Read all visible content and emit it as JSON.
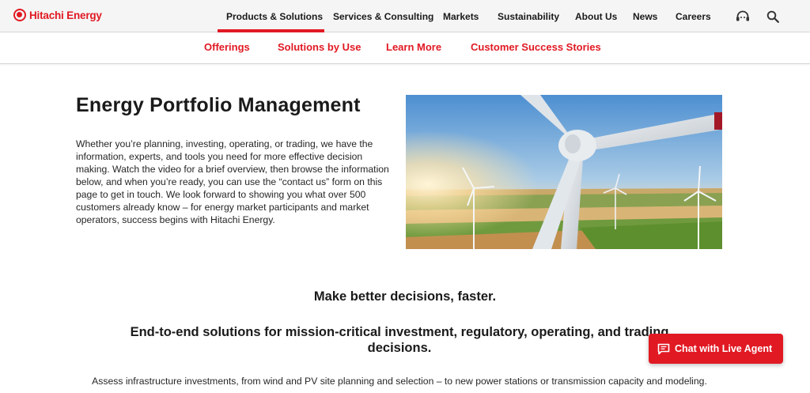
{
  "brand": {
    "name": "Hitachi Energy",
    "color": "#e11923"
  },
  "nav": {
    "items": [
      {
        "label": "Products & Solutions",
        "active": true
      },
      {
        "label": "Services & Consulting",
        "active": false
      },
      {
        "label": "Markets",
        "active": false
      },
      {
        "label": "Sustainability",
        "active": false
      },
      {
        "label": "About Us",
        "active": false
      },
      {
        "label": "News",
        "active": false
      },
      {
        "label": "Careers",
        "active": false
      }
    ],
    "icons": [
      "support-headset-icon",
      "search-icon"
    ]
  },
  "subnav": {
    "items": [
      {
        "label": "Offerings"
      },
      {
        "label": "Solutions by Use"
      },
      {
        "label": "Learn More"
      },
      {
        "label": "Customer Success Stories"
      }
    ]
  },
  "hero": {
    "title": "Energy Portfolio Management",
    "intro": "Whether you’re planning, investing, operating, or trading, we have the information, experts, and tools you need for more effective decision making. Watch the video for a brief overview, then browse the information below, and when you’re ready, you can use the “contact us” form on this page to get in touch. We look forward to showing you what over 500 customers already know – for energy market participants and market operators, success begins with Hitachi Energy.",
    "image": "wind-turbines-photo"
  },
  "content": {
    "heading": "Make better decisions, faster.",
    "subheading": "End-to-end solutions for mission-critical investment, regulatory, operating, and trading decisions.",
    "paragraph": "Assess infrastructure investments, from wind and PV site planning and selection – to new power stations or transmission capacity and modeling."
  },
  "chat": {
    "label": "Chat with Live Agent",
    "icon": "chat-bubble-icon"
  }
}
